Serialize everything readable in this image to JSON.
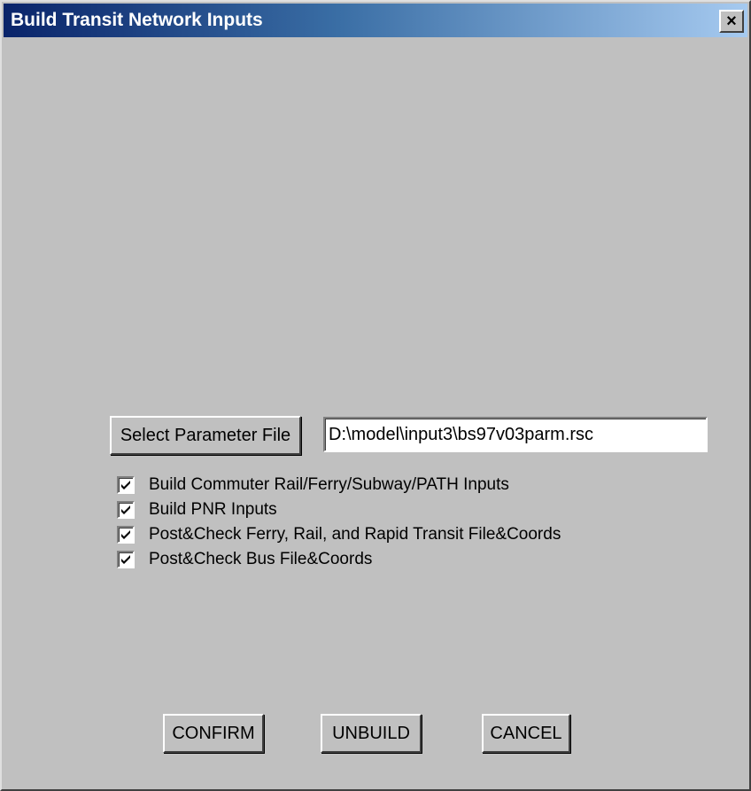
{
  "window": {
    "title": "Build Transit Network Inputs",
    "close_label": "×"
  },
  "parameter": {
    "button_label": "Select Parameter File",
    "file_path": "D:\\model\\input3\\bs97v03parm.rsc"
  },
  "options": [
    {
      "label": "Build Commuter Rail/Ferry/Subway/PATH Inputs",
      "checked": true
    },
    {
      "label": "Build PNR Inputs",
      "checked": true
    },
    {
      "label": "Post&Check Ferry, Rail, and Rapid Transit File&Coords",
      "checked": true
    },
    {
      "label": "Post&Check Bus File&Coords",
      "checked": true
    }
  ],
  "actions": {
    "confirm_label": "CONFIRM",
    "unbuild_label": "UNBUILD",
    "cancel_label": "CANCEL"
  }
}
